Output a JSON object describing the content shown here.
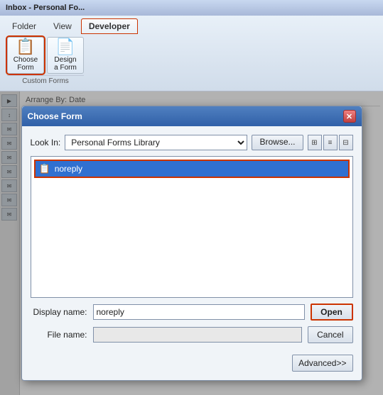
{
  "titlebar": {
    "text": "Inbox - Personal Fo..."
  },
  "ribbon": {
    "tabs": [
      {
        "label": "Folder",
        "active": false
      },
      {
        "label": "View",
        "active": false
      },
      {
        "label": "Developer",
        "active": true
      }
    ],
    "group": {
      "label": "Custom Forms",
      "buttons": [
        {
          "label": "Choose\nForm",
          "icon": "📋",
          "outlined": true
        },
        {
          "label": "Design\na Form",
          "icon": "📄",
          "outlined": false
        }
      ]
    }
  },
  "sidebar": {
    "items": [
      "▶",
      "↕",
      "✉",
      "✉",
      "✉",
      "✉",
      "✉",
      "✉",
      "✉"
    ]
  },
  "email_list": {
    "header": "Arrange By: Date",
    "rows": []
  },
  "dialog": {
    "title": "Choose Form",
    "close_btn": "✕",
    "look_in_label": "Look In:",
    "look_in_value": "Personal Forms Library",
    "browse_btn": "Browse...",
    "forms": [
      {
        "label": "noreply",
        "selected": true
      }
    ],
    "display_name_label": "Display name:",
    "display_name_value": "noreply",
    "file_name_label": "File name:",
    "file_name_value": "",
    "open_btn": "Open",
    "cancel_btn": "Cancel",
    "advanced_btn": "Advanced>>"
  }
}
